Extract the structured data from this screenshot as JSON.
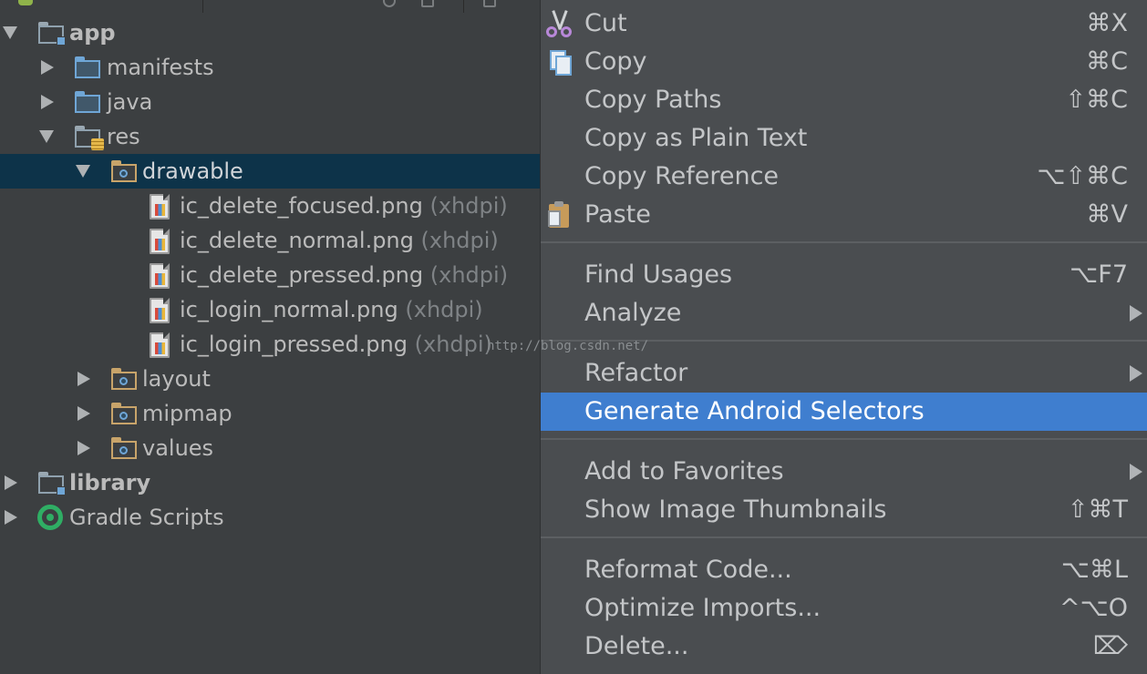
{
  "tree": {
    "items": [
      {
        "label": "app",
        "suffix": ""
      },
      {
        "label": "manifests",
        "suffix": ""
      },
      {
        "label": "java",
        "suffix": ""
      },
      {
        "label": "res",
        "suffix": ""
      },
      {
        "label": "drawable",
        "suffix": ""
      },
      {
        "label": "ic_delete_focused.png",
        "suffix": "(xhdpi)"
      },
      {
        "label": "ic_delete_normal.png",
        "suffix": "(xhdpi)"
      },
      {
        "label": "ic_delete_pressed.png",
        "suffix": "(xhdpi)"
      },
      {
        "label": "ic_login_normal.png",
        "suffix": "(xhdpi)"
      },
      {
        "label": "ic_login_pressed.png",
        "suffix": "(xhdpi)"
      },
      {
        "label": "layout",
        "suffix": ""
      },
      {
        "label": "mipmap",
        "suffix": ""
      },
      {
        "label": "values",
        "suffix": ""
      },
      {
        "label": "library",
        "suffix": ""
      },
      {
        "label": "Gradle Scripts",
        "suffix": ""
      }
    ],
    "selected": "drawable"
  },
  "watermark": "http://blog.csdn.net/",
  "menu": {
    "items": [
      {
        "label": "Cut",
        "shortcut": "⌘X",
        "icon": "scissors-icon"
      },
      {
        "label": "Copy",
        "shortcut": "⌘C",
        "icon": "copy-icon"
      },
      {
        "label": "Copy Paths",
        "shortcut": "⇧⌘C",
        "icon": ""
      },
      {
        "label": "Copy as Plain Text",
        "shortcut": "",
        "icon": ""
      },
      {
        "label": "Copy Reference",
        "shortcut": "⌥⇧⌘C",
        "icon": ""
      },
      {
        "label": "Paste",
        "shortcut": "⌘V",
        "icon": "paste-icon"
      },
      {
        "label": "Find Usages",
        "shortcut": "⌥F7",
        "icon": ""
      },
      {
        "label": "Analyze",
        "shortcut": "",
        "submenu": true
      },
      {
        "label": "Refactor",
        "shortcut": "",
        "submenu": true
      },
      {
        "label": "Generate Android Selectors",
        "shortcut": "",
        "highlighted": true
      },
      {
        "label": "Add to Favorites",
        "shortcut": "",
        "submenu": true
      },
      {
        "label": "Show Image Thumbnails",
        "shortcut": "⇧⌘T"
      },
      {
        "label": "Reformat Code...",
        "shortcut": "⌥⌘L"
      },
      {
        "label": "Optimize Imports...",
        "shortcut": "^⌥O"
      },
      {
        "label": "Delete...",
        "shortcut": "⌦"
      }
    ]
  },
  "colors": {
    "background": "#3c3f41",
    "selection": "#0d3349",
    "menu_background": "#4a4d50",
    "menu_highlight": "#3f7ecf"
  }
}
